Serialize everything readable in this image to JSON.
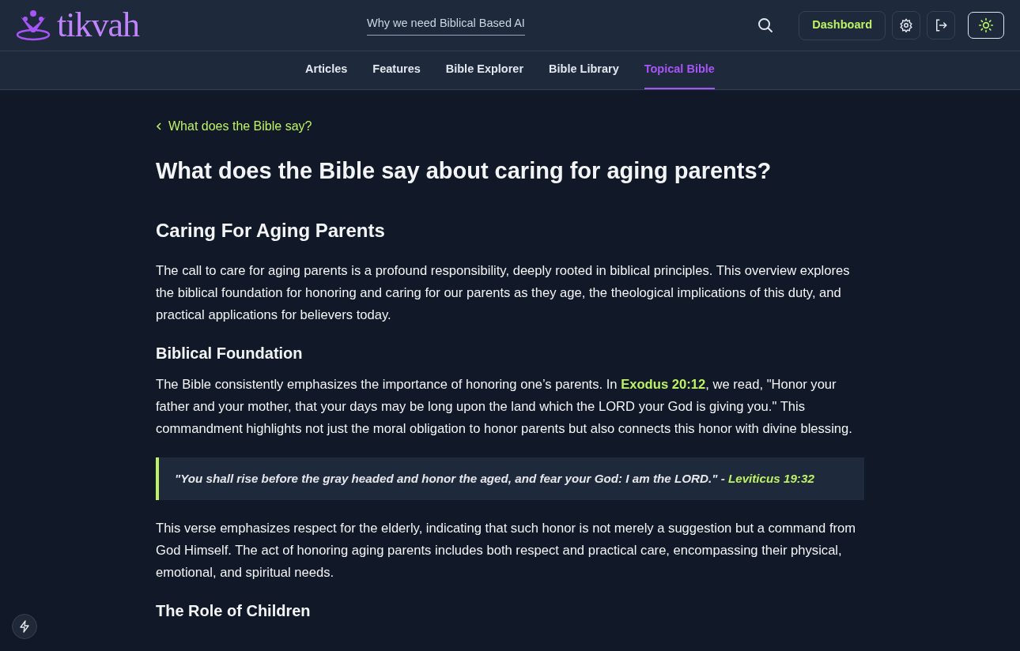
{
  "header": {
    "logo_text": "tikvah",
    "promo_link": "Why we need Biblical Based AI",
    "dashboard_button": "Dashboard"
  },
  "nav": [
    {
      "label": "Articles",
      "selected": false
    },
    {
      "label": "Features",
      "selected": false
    },
    {
      "label": "Bible Explorer",
      "selected": false
    },
    {
      "label": "Bible Library",
      "selected": false
    },
    {
      "label": "Topical Bible",
      "selected": true
    }
  ],
  "back_link": "What does the Bible say?",
  "title": "What does the Bible say about caring for aging parents?",
  "blocks": [
    {
      "kind": "h2",
      "text": "Caring For Aging Parents"
    },
    {
      "kind": "p",
      "parts": [
        {
          "text": "The call to care for aging parents is a profound responsibility, deeply rooted in biblical principles. This overview explores the biblical foundation for honoring and caring for our parents as they age, the theological implications of this duty, and practical applications for believers today."
        }
      ]
    },
    {
      "kind": "h3",
      "text": "Biblical Foundation"
    },
    {
      "kind": "p",
      "parts": [
        {
          "text": "The Bible consistently emphasizes the importance of honoring one’s parents. In "
        },
        {
          "link": "Exodus 20:12"
        },
        {
          "text": ", we read, \"Honor your father and your mother, that your days may be long upon the land which the LORD your God is giving you.\" This commandment highlights not just the moral obligation to honor parents but also connects this honor with divine blessing."
        }
      ]
    },
    {
      "kind": "quote",
      "parts": [
        {
          "text": "\"You shall rise before the gray headed and honor the aged, and fear your God: I am the LORD.\" - "
        },
        {
          "link": "Leviticus 19:32"
        }
      ]
    },
    {
      "kind": "p",
      "parts": [
        {
          "text": "This verse emphasizes respect for the elderly, indicating that such honor is not merely a suggestion but a command from God Himself. The act of honoring aging parents includes both respect and practical care, encompassing their physical, emotional, and spiritual needs."
        }
      ]
    },
    {
      "kind": "h3",
      "text": "The Role of Children"
    }
  ]
}
